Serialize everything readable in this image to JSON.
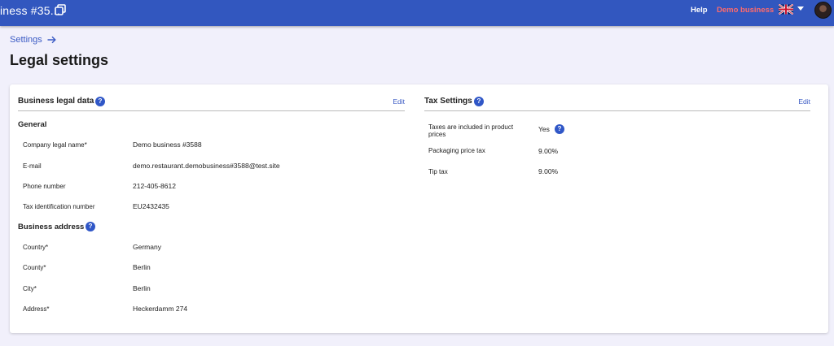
{
  "header": {
    "app_title": "iness #35...",
    "help_label": "Help",
    "business_label": "Demo business",
    "icons": {
      "copy": "copy-icon",
      "language": "uk-flag-icon",
      "dropdown": "caret-down-icon",
      "user": "avatar"
    },
    "brand_color": "#3257bf",
    "business_color": "#ff6b6b"
  },
  "breadcrumb": {
    "label": "Settings",
    "icon": "arrow-right-icon"
  },
  "page_title": "Legal settings",
  "business_legal": {
    "title": "Business legal data",
    "edit_label": "Edit",
    "general": {
      "title": "General",
      "fields": [
        {
          "label": "Company legal name*",
          "value": "Demo business #3588"
        },
        {
          "label": "E-mail",
          "value": "demo.restaurant.demobusiness#3588@test.site"
        },
        {
          "label": "Phone number",
          "value": "212-405-8612"
        },
        {
          "label": "Tax identification number",
          "value": "EU2432435"
        }
      ]
    },
    "address": {
      "title": "Business address",
      "fields": [
        {
          "label": "Country*",
          "value": "Germany"
        },
        {
          "label": "County*",
          "value": "Berlin"
        },
        {
          "label": "City*",
          "value": "Berlin"
        },
        {
          "label": "Address*",
          "value": "Heckerdamm 274"
        }
      ]
    }
  },
  "tax_settings": {
    "title": "Tax Settings",
    "edit_label": "Edit",
    "fields": [
      {
        "label": "Taxes are included in product prices",
        "value": "Yes"
      },
      {
        "label": "Packaging price tax",
        "value": "9.00%"
      },
      {
        "label": "Tip tax",
        "value": "9.00%"
      }
    ]
  },
  "help_glyph": "?"
}
